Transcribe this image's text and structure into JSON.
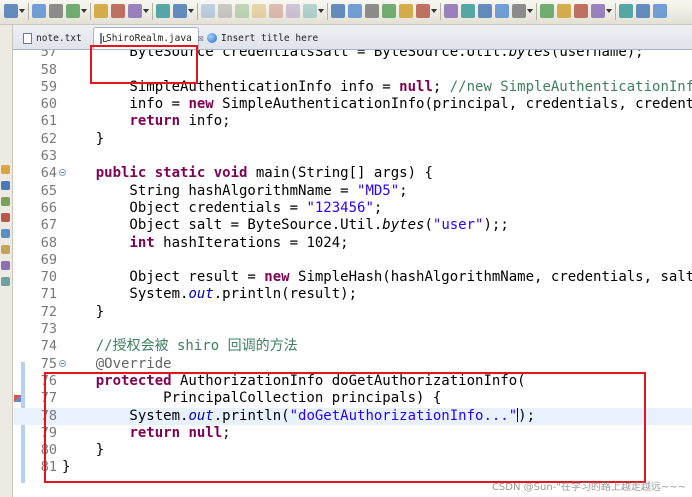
{
  "toolbar": {
    "icons": [
      "menu-dropdown-icon",
      "save-icon",
      "save-all-icon",
      "print-icon",
      "toggle-mark-icon",
      "toggle-block-icon",
      "show-whitespace-icon",
      "undo-icon",
      "redo-icon",
      "back-icon",
      "resume-icon",
      "suspend-icon",
      "terminate-icon",
      "step-into-icon",
      "step-over-icon",
      "step-return-icon",
      "build-icon",
      "run-icon",
      "debug-icon",
      "new-server-icon",
      "coverage-icon",
      "external-tools-icon",
      "new-wizard-icon",
      "new-package-icon",
      "new-class-icon",
      "open-type-icon",
      "open-task-icon",
      "search-icon",
      "open-folder-icon",
      "new-folder-icon",
      "pin-icon",
      "light-bulb-icon",
      "highlighter-icon",
      "next-annotation-icon"
    ]
  },
  "tabs": [
    {
      "label": "note.txt",
      "icon": "text-file-icon",
      "active": false
    },
    {
      "label": "ShiroRealm.java",
      "icon": "java-file-icon",
      "active": true,
      "close": "☒"
    },
    {
      "label": "Insert title here",
      "icon": "globe-icon",
      "active": false
    }
  ],
  "editor": {
    "lines": [
      {
        "num": "57",
        "tokens": [
          [
            "",
            "        ByteSource credentialsSalt = ByteSource.Util."
          ],
          [
            "t-it",
            "bytes"
          ],
          [
            "",
            "(username);"
          ]
        ]
      },
      {
        "num": "58",
        "tokens": []
      },
      {
        "num": "59",
        "tokens": [
          [
            "",
            "        SimpleAuthenticationInfo info = "
          ],
          [
            "t-kw",
            "null"
          ],
          [
            "",
            "; "
          ],
          [
            "t-com",
            "//new SimpleAuthenticationInfo(principal, credentials, realmName);"
          ]
        ]
      },
      {
        "num": "60",
        "tokens": [
          [
            "",
            "        info = "
          ],
          [
            "t-kw",
            "new"
          ],
          [
            "",
            " SimpleAuthenticationInfo(principal, credentials, credentialsSalt, realmName);"
          ]
        ]
      },
      {
        "num": "61",
        "tokens": [
          [
            "",
            "        "
          ],
          [
            "t-kw",
            "return"
          ],
          [
            "",
            " info;"
          ]
        ]
      },
      {
        "num": "62",
        "tokens": [
          [
            "",
            "    }"
          ]
        ]
      },
      {
        "num": "63",
        "tokens": []
      },
      {
        "num": "64",
        "fold": true,
        "tokens": [
          [
            "",
            "    "
          ],
          [
            "t-kw",
            "public static void"
          ],
          [
            "",
            " main(String[] args) {"
          ]
        ]
      },
      {
        "num": "65",
        "tokens": [
          [
            "",
            "        String hashAlgorithmName = "
          ],
          [
            "t-str",
            "\"MD5\""
          ],
          [
            "",
            ";"
          ]
        ]
      },
      {
        "num": "66",
        "tokens": [
          [
            "",
            "        Object credentials = "
          ],
          [
            "t-str",
            "\"123456\""
          ],
          [
            "",
            ";"
          ]
        ]
      },
      {
        "num": "67",
        "tokens": [
          [
            "",
            "        Object salt = ByteSource.Util."
          ],
          [
            "t-it",
            "bytes"
          ],
          [
            "",
            "("
          ],
          [
            "t-str",
            "\"user\""
          ],
          [
            "",
            ");;"
          ]
        ]
      },
      {
        "num": "68",
        "tokens": [
          [
            "",
            "        "
          ],
          [
            "t-kw",
            "int"
          ],
          [
            "",
            " hashIterations = 1024;"
          ]
        ]
      },
      {
        "num": "69",
        "tokens": []
      },
      {
        "num": "70",
        "tokens": [
          [
            "",
            "        Object result = "
          ],
          [
            "t-kw",
            "new"
          ],
          [
            "",
            " SimpleHash(hashAlgorithmName, credentials, salt, hashIterations);"
          ]
        ]
      },
      {
        "num": "71",
        "tokens": [
          [
            "",
            "        System."
          ],
          [
            "t-fld",
            "out"
          ],
          [
            "",
            ".println(result);"
          ]
        ]
      },
      {
        "num": "72",
        "tokens": [
          [
            "",
            "    }"
          ]
        ]
      },
      {
        "num": "73",
        "tokens": []
      },
      {
        "num": "74",
        "tokens": [
          [
            "",
            "    "
          ],
          [
            "t-com",
            "//授权会被 shiro 回调的方法"
          ]
        ]
      },
      {
        "num": "75",
        "fold": true,
        "tokens": [
          [
            "",
            "    "
          ],
          [
            "t-ann",
            "@Override"
          ]
        ]
      },
      {
        "num": "76",
        "marker": true,
        "tokens": [
          [
            "",
            "    "
          ],
          [
            "t-kw",
            "protected"
          ],
          [
            "",
            " AuthorizationInfo doGetAuthorizationInfo("
          ]
        ]
      },
      {
        "num": "77",
        "tokens": [
          [
            "",
            "            PrincipalCollection principals) {"
          ]
        ]
      },
      {
        "num": "78",
        "current": true,
        "tokens": [
          [
            "",
            "        System."
          ],
          [
            "t-fld",
            "out"
          ],
          [
            "",
            ".println("
          ],
          [
            "t-str",
            "\"doGetAuthorizationInfo...\""
          ],
          [
            "",
            ");"
          ]
        ]
      },
      {
        "num": "79",
        "tokens": [
          [
            "",
            "        "
          ],
          [
            "t-kw",
            "return null"
          ],
          [
            "",
            ";"
          ]
        ]
      },
      {
        "num": "80",
        "tokens": [
          [
            "",
            "    }"
          ]
        ]
      },
      {
        "num": "81",
        "tokens": [
          [
            "",
            "}"
          ]
        ]
      }
    ]
  },
  "watermark": "CSDN @Sun-\"在学习的路上越走越远~~~"
}
